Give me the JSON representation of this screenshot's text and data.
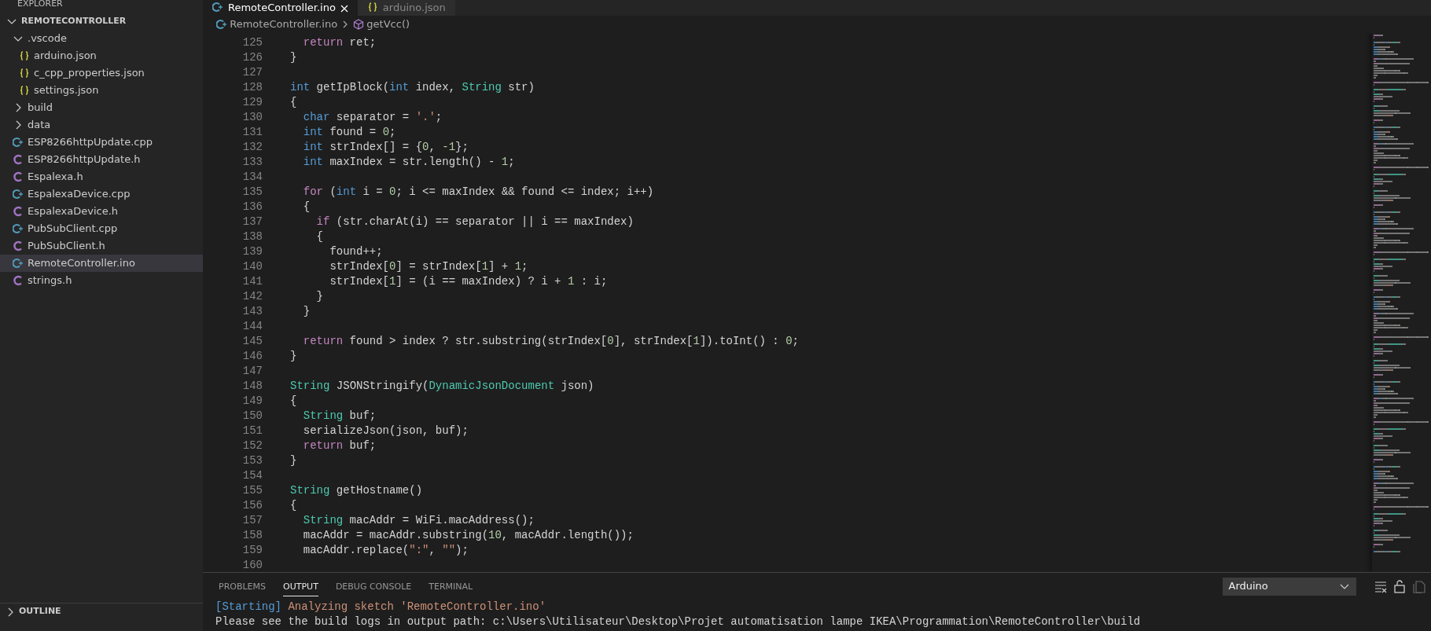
{
  "sidebar": {
    "title": "EXPLORER",
    "tree": [
      {
        "label": "REMOTECONTROLLER",
        "kind": "root",
        "expanded": true,
        "selected": false,
        "children": [
          {
            "label": ".vscode",
            "kind": "folder",
            "expanded": true,
            "selected": false,
            "children": [
              {
                "label": "arduino.json",
                "kind": "json",
                "selected": false
              },
              {
                "label": "c_cpp_properties.json",
                "kind": "json",
                "selected": false
              },
              {
                "label": "settings.json",
                "kind": "json",
                "selected": false
              }
            ]
          },
          {
            "label": "build",
            "kind": "folder",
            "expanded": false,
            "selected": false
          },
          {
            "label": "data",
            "kind": "folder",
            "expanded": false,
            "selected": false
          },
          {
            "label": "ESP8266httpUpdate.cpp",
            "kind": "cpp",
            "selected": false
          },
          {
            "label": "ESP8266httpUpdate.h",
            "kind": "h",
            "selected": false
          },
          {
            "label": "Espalexa.h",
            "kind": "h",
            "selected": false
          },
          {
            "label": "EspalexaDevice.cpp",
            "kind": "cpp",
            "selected": false
          },
          {
            "label": "EspalexaDevice.h",
            "kind": "h",
            "selected": false
          },
          {
            "label": "PubSubClient.cpp",
            "kind": "cpp",
            "selected": false
          },
          {
            "label": "PubSubClient.h",
            "kind": "h",
            "selected": false
          },
          {
            "label": "RemoteController.ino",
            "kind": "cpp",
            "selected": true
          },
          {
            "label": "strings.h",
            "kind": "h",
            "selected": false
          }
        ]
      }
    ],
    "sections": [
      {
        "label": "OUTLINE",
        "expanded": false
      }
    ]
  },
  "tabs": [
    {
      "label": "RemoteController.ino",
      "kind": "cpp",
      "selected": true
    },
    {
      "label": "arduino.json",
      "kind": "json",
      "selected": false
    }
  ],
  "breadcrumb": [
    {
      "label": "RemoteController.ino",
      "kind": "cpp"
    },
    {
      "label": "getVcc()",
      "kind": "method"
    }
  ],
  "code": [
    {
      "no": "125",
      "tokens": [
        {
          "text": "  return",
          "kind": "c"
        },
        {
          "text": " ret;",
          "kind": "p"
        }
      ]
    },
    {
      "no": "126",
      "tokens": [
        {
          "text": "}",
          "kind": "p"
        }
      ]
    },
    {
      "no": "127"
    },
    {
      "no": "128",
      "tokens": [
        {
          "text": "int",
          "kind": "k"
        },
        {
          "text": " getIpBlock(",
          "kind": "p"
        },
        {
          "text": "int",
          "kind": "k"
        },
        {
          "text": " index, ",
          "kind": "p"
        },
        {
          "text": "String",
          "kind": "t"
        },
        {
          "text": " str)",
          "kind": "p"
        }
      ]
    },
    {
      "no": "129",
      "tokens": [
        {
          "text": "{",
          "kind": "p"
        }
      ]
    },
    {
      "no": "130",
      "tokens": [
        {
          "text": "  char",
          "kind": "k"
        },
        {
          "text": " separator = ",
          "kind": "p"
        },
        {
          "text": "'.'",
          "kind": "s"
        },
        {
          "text": ";",
          "kind": "p"
        }
      ]
    },
    {
      "no": "131",
      "tokens": [
        {
          "text": "  int",
          "kind": "k"
        },
        {
          "text": " found = ",
          "kind": "p"
        },
        {
          "text": "0",
          "kind": "n"
        },
        {
          "text": ";",
          "kind": "p"
        }
      ]
    },
    {
      "no": "132",
      "tokens": [
        {
          "text": "  int",
          "kind": "k"
        },
        {
          "text": " strIndex[] = {",
          "kind": "p"
        },
        {
          "text": "0",
          "kind": "n"
        },
        {
          "text": ", ",
          "kind": "p"
        },
        {
          "text": "-1",
          "kind": "n"
        },
        {
          "text": "};",
          "kind": "p"
        }
      ]
    },
    {
      "no": "133",
      "tokens": [
        {
          "text": "  int",
          "kind": "k"
        },
        {
          "text": " maxIndex = str.length() - ",
          "kind": "p"
        },
        {
          "text": "1",
          "kind": "n"
        },
        {
          "text": ";",
          "kind": "p"
        }
      ]
    },
    {
      "no": "134"
    },
    {
      "no": "135",
      "tokens": [
        {
          "text": "  for",
          "kind": "c"
        },
        {
          "text": " (",
          "kind": "p"
        },
        {
          "text": "int",
          "kind": "k"
        },
        {
          "text": " i = ",
          "kind": "p"
        },
        {
          "text": "0",
          "kind": "n"
        },
        {
          "text": "; i <= maxIndex && found <= index; i++)",
          "kind": "p"
        }
      ]
    },
    {
      "no": "136",
      "tokens": [
        {
          "text": "  {",
          "kind": "p"
        }
      ]
    },
    {
      "no": "137",
      "tokens": [
        {
          "text": "    if",
          "kind": "c"
        },
        {
          "text": " (str.charAt(i) == separator || i == maxIndex)",
          "kind": "p"
        }
      ]
    },
    {
      "no": "138",
      "tokens": [
        {
          "text": "    {",
          "kind": "p"
        }
      ]
    },
    {
      "no": "139",
      "tokens": [
        {
          "text": "      found++;",
          "kind": "p"
        }
      ]
    },
    {
      "no": "140",
      "tokens": [
        {
          "text": "      strIndex[",
          "kind": "p"
        },
        {
          "text": "0",
          "kind": "n"
        },
        {
          "text": "] = strIndex[",
          "kind": "p"
        },
        {
          "text": "1",
          "kind": "n"
        },
        {
          "text": "] + ",
          "kind": "p"
        },
        {
          "text": "1",
          "kind": "n"
        },
        {
          "text": ";",
          "kind": "p"
        }
      ]
    },
    {
      "no": "141",
      "tokens": [
        {
          "text": "      strIndex[",
          "kind": "p"
        },
        {
          "text": "1",
          "kind": "n"
        },
        {
          "text": "] = (i == maxIndex) ? i + ",
          "kind": "p"
        },
        {
          "text": "1",
          "kind": "n"
        },
        {
          "text": " : i;",
          "kind": "p"
        }
      ]
    },
    {
      "no": "142",
      "tokens": [
        {
          "text": "    }",
          "kind": "p"
        }
      ]
    },
    {
      "no": "143",
      "tokens": [
        {
          "text": "  }",
          "kind": "p"
        }
      ]
    },
    {
      "no": "144"
    },
    {
      "no": "145",
      "tokens": [
        {
          "text": "  return",
          "kind": "c"
        },
        {
          "text": " found > index ? str.substring(strIndex[",
          "kind": "p"
        },
        {
          "text": "0",
          "kind": "n"
        },
        {
          "text": "], strIndex[",
          "kind": "p"
        },
        {
          "text": "1",
          "kind": "n"
        },
        {
          "text": "]).toInt() : ",
          "kind": "p"
        },
        {
          "text": "0",
          "kind": "n"
        },
        {
          "text": ";",
          "kind": "p"
        }
      ]
    },
    {
      "no": "146",
      "tokens": [
        {
          "text": "}",
          "kind": "p"
        }
      ]
    },
    {
      "no": "147"
    },
    {
      "no": "148",
      "tokens": [
        {
          "text": "String",
          "kind": "t"
        },
        {
          "text": " JSONStringify(",
          "kind": "p"
        },
        {
          "text": "DynamicJsonDocument",
          "kind": "t"
        },
        {
          "text": " json)",
          "kind": "p"
        }
      ]
    },
    {
      "no": "149",
      "tokens": [
        {
          "text": "{",
          "kind": "p"
        }
      ]
    },
    {
      "no": "150",
      "tokens": [
        {
          "text": "  String",
          "kind": "t"
        },
        {
          "text": " buf;",
          "kind": "p"
        }
      ]
    },
    {
      "no": "151",
      "tokens": [
        {
          "text": "  serializeJson(json, buf);",
          "kind": "p"
        }
      ]
    },
    {
      "no": "152",
      "tokens": [
        {
          "text": "  return",
          "kind": "c"
        },
        {
          "text": " buf;",
          "kind": "p"
        }
      ]
    },
    {
      "no": "153",
      "tokens": [
        {
          "text": "}",
          "kind": "p"
        }
      ]
    },
    {
      "no": "154"
    },
    {
      "no": "155",
      "tokens": [
        {
          "text": "String",
          "kind": "t"
        },
        {
          "text": " getHostname()",
          "kind": "p"
        }
      ]
    },
    {
      "no": "156",
      "tokens": [
        {
          "text": "{",
          "kind": "p"
        }
      ]
    },
    {
      "no": "157",
      "tokens": [
        {
          "text": "  String",
          "kind": "t"
        },
        {
          "text": " macAddr = WiFi.macAddress();",
          "kind": "p"
        }
      ]
    },
    {
      "no": "158",
      "tokens": [
        {
          "text": "  macAddr = macAddr.substring(",
          "kind": "p"
        },
        {
          "text": "10",
          "kind": "n"
        },
        {
          "text": ", macAddr.length());",
          "kind": "p"
        }
      ]
    },
    {
      "no": "159",
      "tokens": [
        {
          "text": "  macAddr.replace(",
          "kind": "p"
        },
        {
          "text": "\":\"",
          "kind": "s"
        },
        {
          "text": ", ",
          "kind": "p"
        },
        {
          "text": "\"\"",
          "kind": "s"
        },
        {
          "text": ");",
          "kind": "p"
        }
      ]
    },
    {
      "no": "160"
    }
  ],
  "panel": {
    "tabs": [
      {
        "label": "PROBLEMS",
        "selected": false
      },
      {
        "label": "OUTPUT",
        "selected": true
      },
      {
        "label": "DEBUG CONSOLE",
        "selected": false
      },
      {
        "label": "TERMINAL",
        "selected": false
      }
    ],
    "channel": "Arduino",
    "output": [
      {
        "tokens": [
          {
            "text": "[Starting]",
            "kind": "b"
          },
          {
            "text": " Analyzing sketch 'RemoteController.ino'",
            "kind": "o"
          }
        ]
      },
      {
        "tokens": [
          {
            "text": "Please see the build logs in output path: c:\\Users\\Utilisateur\\Desktop\\Projet automatisation lampe IKEA\\Programmation\\RemoteController\\build",
            "kind": "p"
          }
        ]
      }
    ]
  }
}
